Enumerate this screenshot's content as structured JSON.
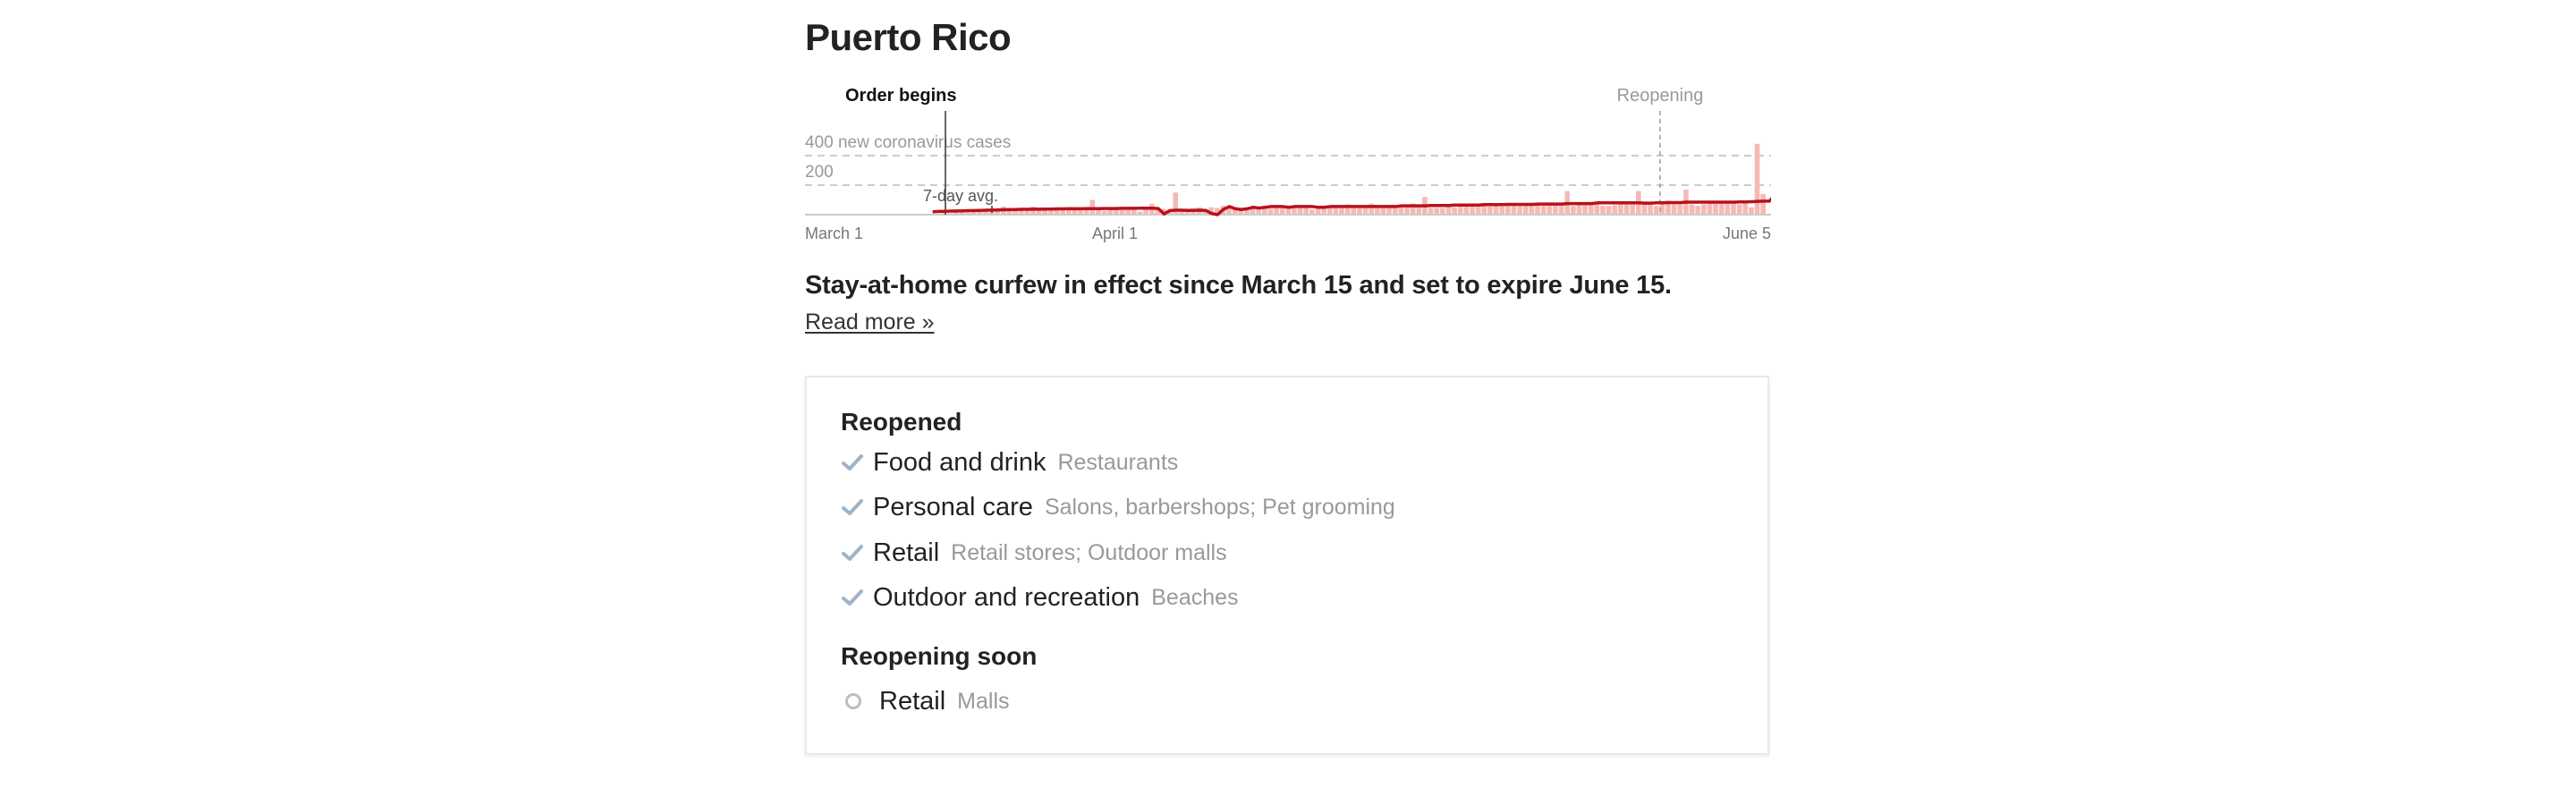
{
  "title": "Puerto Rico",
  "chart_data": {
    "type": "bar",
    "x_start": "March 1",
    "x_end": "June 5",
    "xtick_labels": [
      "March 1",
      "April 1",
      "June 5"
    ],
    "gridline_labels": [
      "400 new coronavirus cases",
      "200"
    ],
    "ylim": [
      0,
      400
    ],
    "annotations": {
      "order": "Order begins",
      "reopening": "Reopening",
      "avg": "7-day avg."
    },
    "bar_color": "#f4b9b7",
    "avg_line_color": "#b8111b",
    "values": [
      0,
      0,
      0,
      0,
      0,
      0,
      0,
      0,
      0,
      0,
      0,
      0,
      0,
      0,
      0,
      0,
      0,
      0,
      0,
      0,
      5,
      5,
      5,
      10,
      10,
      15,
      15,
      15,
      20,
      20,
      25,
      20,
      35,
      55,
      45,
      35,
      40,
      35,
      55,
      40,
      40,
      40,
      35,
      40,
      50,
      45,
      40,
      45,
      100,
      45,
      25,
      35,
      40,
      35,
      35,
      40,
      20,
      50,
      75,
      40,
      40,
      35,
      150,
      40,
      40,
      45,
      50,
      35,
      50,
      45,
      60,
      45,
      40,
      45,
      35,
      45,
      55,
      45,
      40,
      45,
      60,
      55,
      45,
      55,
      60,
      35,
      45,
      55,
      50,
      55,
      50,
      70,
      45,
      50,
      60,
      75,
      45,
      50,
      65,
      65,
      55,
      55,
      75,
      60,
      120,
      45,
      45,
      45,
      55,
      50,
      60,
      55,
      60,
      65,
      60,
      55,
      60,
      55,
      60,
      80,
      60,
      60,
      65,
      65,
      60,
      65,
      70,
      70,
      160,
      60,
      65,
      65,
      70,
      70,
      60,
      60,
      65,
      75,
      80,
      70,
      160,
      80,
      80,
      60,
      80,
      95,
      70,
      70,
      170,
      70,
      60,
      70,
      75,
      75,
      90,
      80,
      80,
      70,
      90,
      50,
      480,
      140
    ],
    "avg": [
      2,
      2,
      2,
      3,
      3,
      4,
      5,
      6,
      7,
      8,
      9,
      10,
      11,
      12,
      13,
      14,
      15,
      16,
      17,
      18,
      19,
      20,
      22,
      23,
      24,
      25,
      26,
      27,
      28,
      29,
      30,
      31,
      32,
      33,
      34,
      35,
      36,
      36,
      37,
      37,
      38,
      38,
      39,
      39,
      40,
      40,
      40,
      41,
      41,
      41,
      42,
      42,
      42,
      43,
      43,
      43,
      44,
      44,
      44,
      42,
      5,
      28,
      30,
      30,
      29,
      29,
      30,
      29,
      8,
      0,
      36,
      55,
      40,
      35,
      40,
      50,
      45,
      50,
      55,
      55,
      55,
      50,
      55,
      55,
      55,
      55,
      50,
      50,
      55,
      55,
      55,
      55,
      55,
      55,
      55,
      55,
      55,
      55,
      55,
      55,
      60,
      60,
      60,
      60,
      60,
      62,
      62,
      62,
      62,
      65,
      65,
      65,
      65,
      65,
      68,
      68,
      68,
      68,
      70,
      70,
      70,
      70,
      70,
      72,
      72,
      72,
      72,
      72,
      75,
      75,
      75,
      75,
      75,
      80,
      80,
      80,
      80,
      80,
      80,
      80,
      80,
      78,
      78,
      80,
      80,
      82,
      82,
      82,
      85,
      85,
      85,
      85,
      85,
      85,
      85,
      85,
      85,
      86,
      86,
      88,
      90,
      92,
      92,
      140
    ]
  },
  "summary": "Stay-at-home curfew in effect since March 15 and set to expire June 15.",
  "read_more": "Read more »",
  "card": {
    "sections": [
      {
        "title": "Reopened",
        "items": [
          {
            "name": "Food and drink",
            "detail": "Restaurants"
          },
          {
            "name": "Personal care",
            "detail": "Salons, barbershops; Pet grooming"
          },
          {
            "name": "Retail",
            "detail": "Retail stores; Outdoor malls"
          },
          {
            "name": "Outdoor and recreation",
            "detail": "Beaches"
          }
        ]
      },
      {
        "title": "Reopening soon",
        "items": [
          {
            "name": "Retail",
            "detail": "Malls"
          }
        ]
      }
    ],
    "check_color": "#9fb3c6"
  }
}
